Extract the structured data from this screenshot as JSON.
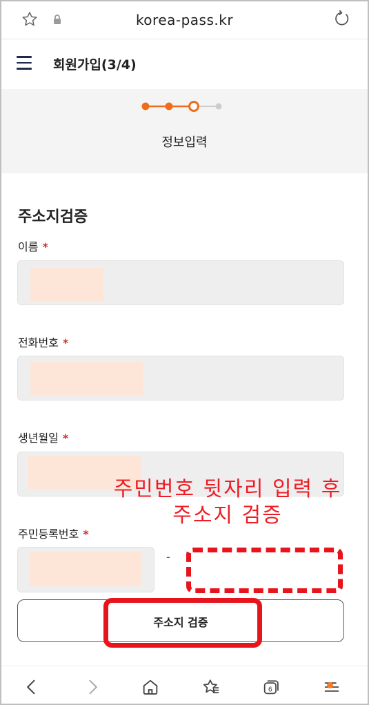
{
  "browser": {
    "url": "korea-pass.kr",
    "icons": [
      "star-icon",
      "lock-icon",
      "reload-icon"
    ]
  },
  "header": {
    "title": "회원가입(3/4)",
    "menu_icon": "hamburger-menu-icon"
  },
  "steps": {
    "current_label": "정보입력",
    "total": 4,
    "current": 3,
    "active_color": "#ef6c1a",
    "inactive_color": "#cccccc"
  },
  "form": {
    "section_title": "주소지검증",
    "required_mark": "*",
    "fields": {
      "name": {
        "label": "이름"
      },
      "phone": {
        "label": "전화번호"
      },
      "birth": {
        "label": "생년월일"
      },
      "rrn": {
        "label": "주민등록번호",
        "separator": "-"
      }
    },
    "verify_button": "주소지 검증"
  },
  "annotation": {
    "text_line1": "주민번호 뒷자리 입력 후",
    "text_line2": "주소지 검증",
    "color": "#ee1c24"
  },
  "bottom_nav": {
    "items": [
      "back-icon",
      "forward-icon",
      "home-icon",
      "bookmarks-icon",
      "tabs-icon",
      "menu-icon"
    ],
    "tabs_count": "6"
  }
}
